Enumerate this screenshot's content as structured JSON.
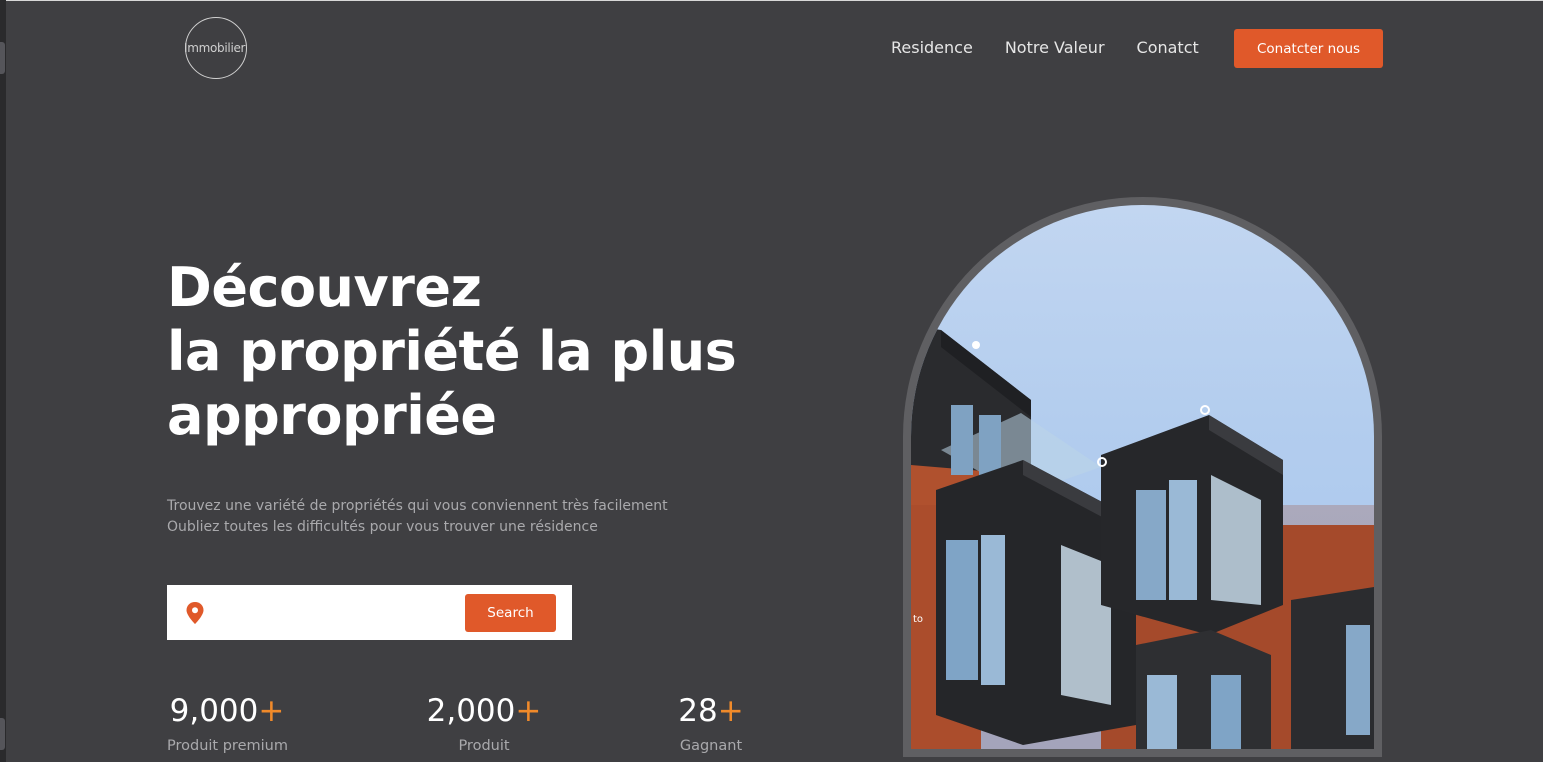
{
  "header": {
    "logo_text": "Immobilier",
    "nav": [
      "Residence",
      "Notre Valeur",
      "Conatct"
    ],
    "cta_label": "Conatcter nous"
  },
  "hero": {
    "title_lines": [
      "Découvrez",
      "la propriété la plus",
      "appropriée"
    ],
    "subtitle_lines": [
      "Trouvez une variété de propriétés qui vous conviennent très facilement",
      "Oubliez toutes les difficultés pour vous trouver une résidence"
    ],
    "search": {
      "placeholder": "",
      "button_label": "Search"
    }
  },
  "stats": [
    {
      "value": "9,000",
      "suffix": "+",
      "label": "Produit premium"
    },
    {
      "value": "2,000",
      "suffix": "+",
      "label": "Produit"
    },
    {
      "value": "28",
      "suffix": "+",
      "label": "Gagnant"
    }
  ],
  "image": {
    "overlay_text": "to"
  },
  "colors": {
    "accent": "#e0592a",
    "plus": "#f08a2a",
    "background": "#3f3f42"
  }
}
